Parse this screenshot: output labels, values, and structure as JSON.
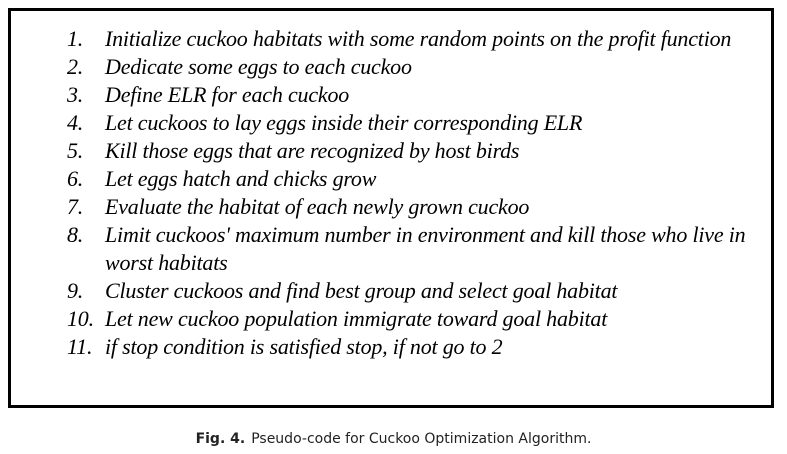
{
  "figure": {
    "steps": [
      {
        "num": "1.",
        "text": "Initialize cuckoo habitats with some random points on the profit function"
      },
      {
        "num": "2.",
        "text": "Dedicate some eggs to each cuckoo"
      },
      {
        "num": "3.",
        "text": "Define ELR for each cuckoo"
      },
      {
        "num": "4.",
        "text": "Let cuckoos to lay eggs inside their corresponding ELR"
      },
      {
        "num": "5.",
        "text": "Kill those eggs that are recognized by host birds"
      },
      {
        "num": "6.",
        "text": "Let eggs hatch and chicks grow"
      },
      {
        "num": "7.",
        "text": "Evaluate the habitat of each newly grown cuckoo"
      },
      {
        "num": "8.",
        "text": "Limit cuckoos' maximum number in environment and kill those who live in worst habitats"
      },
      {
        "num": "9.",
        "text": "Cluster cuckoos and find best group and select goal habitat"
      },
      {
        "num": "10.",
        "text": "Let new cuckoo population immigrate toward goal habitat"
      },
      {
        "num": "11.",
        "text": "if stop condition is satisfied stop, if not  go to 2"
      }
    ]
  },
  "caption": {
    "label": "Fig. 4.",
    "text": "Pseudo-code for Cuckoo Optimization Algorithm."
  }
}
